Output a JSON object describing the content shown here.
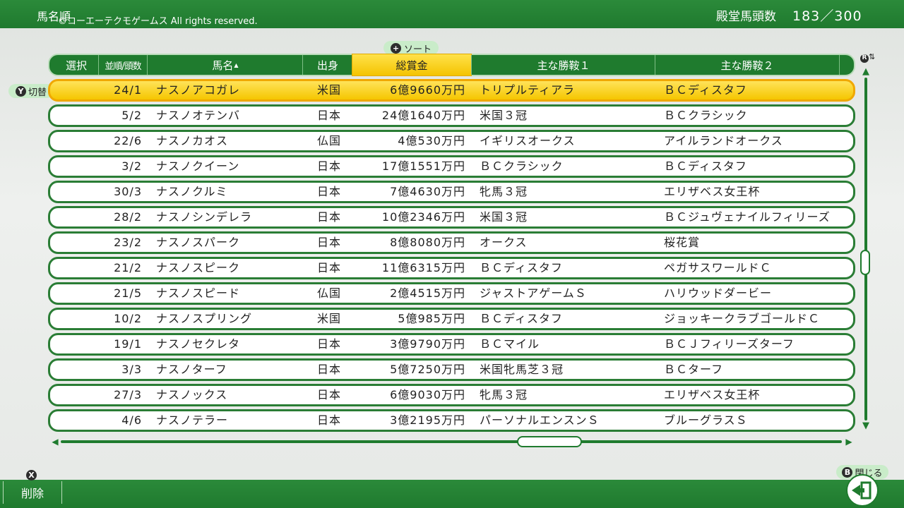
{
  "header": {
    "title": "馬名順",
    "copyright": "©コーエーテクモゲームス All rights reserved.",
    "hof_label": "殿堂馬頭数",
    "hof_count": "183／300"
  },
  "sort_hint": {
    "button": "+",
    "label": "ソート"
  },
  "switch_hint": {
    "button": "Y",
    "label": "切替"
  },
  "columns": {
    "select": "選択",
    "order": "並順/頭数",
    "name": "馬名",
    "origin": "出身",
    "prize": "総賞金",
    "win1": "主な勝鞍１",
    "win2": "主な勝鞍２"
  },
  "rows": [
    {
      "order": "24/1",
      "name": "ナスノアコガレ",
      "origin": "米国",
      "prize": "6億9660万円",
      "win1": "トリプルティアラ",
      "win2": "ＢＣディスタフ"
    },
    {
      "order": "5/2",
      "name": "ナスノオテンバ",
      "origin": "日本",
      "prize": "24億1640万円",
      "win1": "米国３冠",
      "win2": "ＢＣクラシック"
    },
    {
      "order": "22/6",
      "name": "ナスノカオス",
      "origin": "仏国",
      "prize": "4億530万円",
      "win1": "イギリスオークス",
      "win2": "アイルランドオークス"
    },
    {
      "order": "3/2",
      "name": "ナスノクイーン",
      "origin": "日本",
      "prize": "17億1551万円",
      "win1": "ＢＣクラシック",
      "win2": "ＢＣディスタフ"
    },
    {
      "order": "30/3",
      "name": "ナスノクルミ",
      "origin": "日本",
      "prize": "7億4630万円",
      "win1": "牝馬３冠",
      "win2": "エリザベス女王杯"
    },
    {
      "order": "28/2",
      "name": "ナスノシンデレラ",
      "origin": "日本",
      "prize": "10億2346万円",
      "win1": "米国３冠",
      "win2": "ＢＣジュヴェナイルフィリーズ"
    },
    {
      "order": "23/2",
      "name": "ナスノスパーク",
      "origin": "日本",
      "prize": "8億8080万円",
      "win1": "オークス",
      "win2": "桜花賞"
    },
    {
      "order": "21/2",
      "name": "ナスノスピーク",
      "origin": "日本",
      "prize": "11億6315万円",
      "win1": "ＢＣディスタフ",
      "win2": "ペガサスワールドＣ"
    },
    {
      "order": "21/5",
      "name": "ナスノスピード",
      "origin": "仏国",
      "prize": "2億4515万円",
      "win1": "ジャストアゲームＳ",
      "win2": "ハリウッドダービー"
    },
    {
      "order": "10/2",
      "name": "ナスノスプリング",
      "origin": "米国",
      "prize": "5億985万円",
      "win1": "ＢＣディスタフ",
      "win2": "ジョッキークラブゴールドＣ"
    },
    {
      "order": "19/1",
      "name": "ナスノセクレタ",
      "origin": "日本",
      "prize": "3億9790万円",
      "win1": "ＢＣマイル",
      "win2": "ＢＣＪフィリーズターフ"
    },
    {
      "order": "3/3",
      "name": "ナスノターフ",
      "origin": "日本",
      "prize": "5億7250万円",
      "win1": "米国牝馬芝３冠",
      "win2": "ＢＣターフ"
    },
    {
      "order": "27/3",
      "name": "ナスノックス",
      "origin": "日本",
      "prize": "6億9030万円",
      "win1": "牝馬３冠",
      "win2": "エリザベス女王杯"
    },
    {
      "order": "4/6",
      "name": "ナスノテラー",
      "origin": "日本",
      "prize": "3億2195万円",
      "win1": "パーソナルエンスンＳ",
      "win2": "ブルーグラスＳ"
    }
  ],
  "footer": {
    "delete_button": "X",
    "delete_label": "削除",
    "close_button": "B",
    "close_label": "閉じる"
  },
  "scroll": {
    "r_button": "R"
  },
  "colors": {
    "green": "#1f7b2e",
    "highlight": "#f5c600",
    "hint_bg": "#c9ecc9"
  },
  "selected_row_index": 0
}
